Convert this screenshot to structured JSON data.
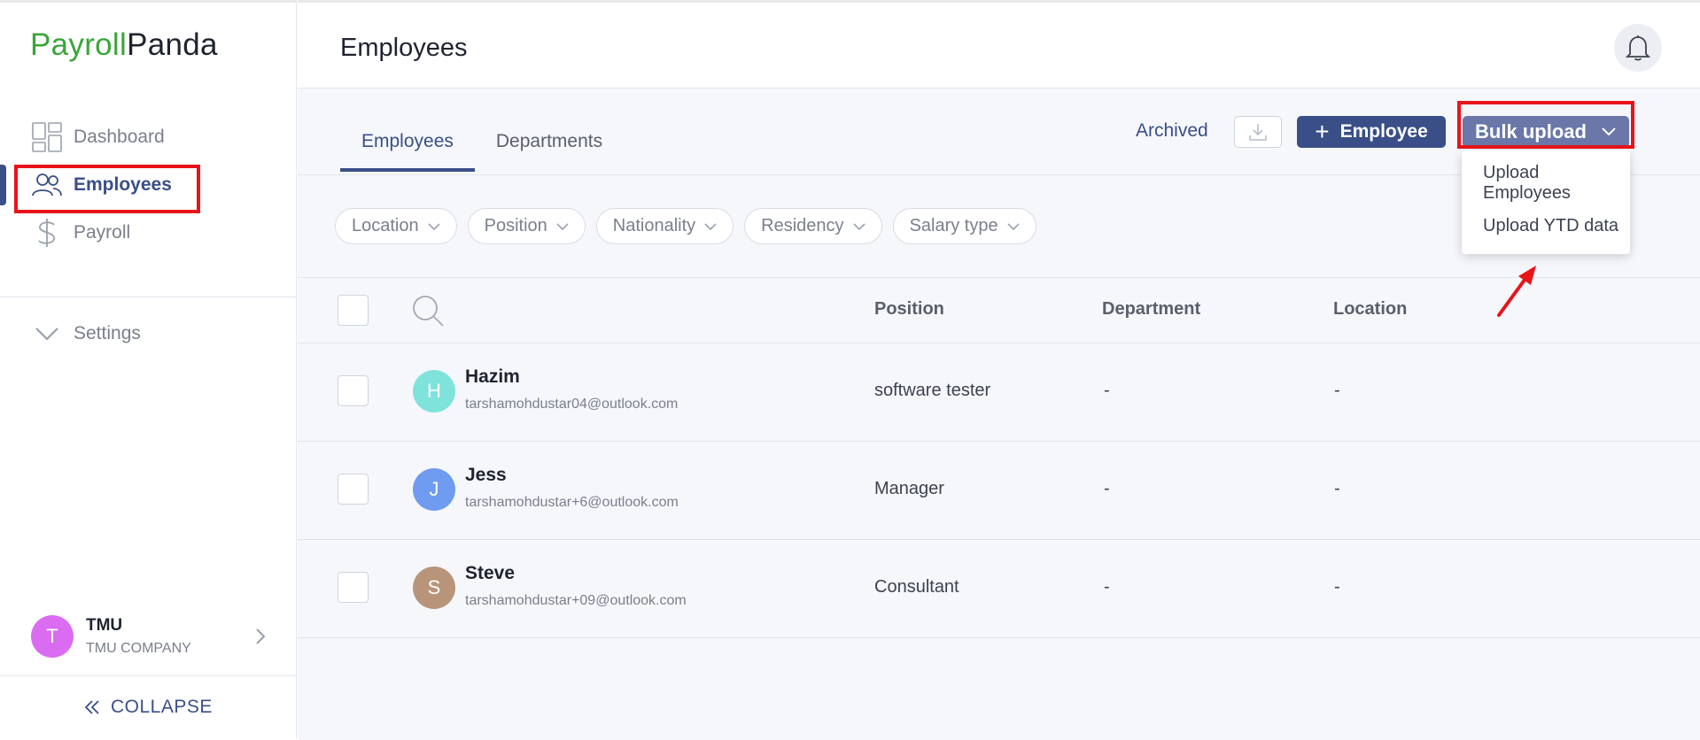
{
  "brand": {
    "part1": "Payroll",
    "part2": "Panda",
    "color_green": "#3aa639",
    "color_dark": "#1f2330"
  },
  "sidebar": {
    "items": [
      {
        "label": "Dashboard",
        "icon": "dashboard-icon"
      },
      {
        "label": "Employees",
        "icon": "users-icon",
        "active": true
      },
      {
        "label": "Payroll",
        "icon": "dollar-icon"
      }
    ],
    "settings": {
      "label": "Settings",
      "icon": "chevron-down-icon"
    },
    "user": {
      "initial": "T",
      "name": "TMU",
      "company": "TMU COMPANY"
    },
    "collapse": {
      "label": "COLLAPSE",
      "icon": "double-chevron-left-icon"
    }
  },
  "header": {
    "title": "Employees",
    "icon": "bell-icon"
  },
  "tabs": [
    {
      "label": "Employees",
      "active": true
    },
    {
      "label": "Departments",
      "active": false
    }
  ],
  "toolbar": {
    "archived_label": "Archived",
    "download_icon": "download-icon",
    "add_employee_label": "Employee",
    "bulk_upload_label": "Bulk upload",
    "bulk_menu": [
      "Upload Employees",
      "Upload YTD data"
    ]
  },
  "filters": [
    "Location",
    "Position",
    "Nationality",
    "Residency",
    "Salary type"
  ],
  "table": {
    "columns": [
      "Position",
      "Department",
      "Location"
    ],
    "rows": [
      {
        "initial": "H",
        "name": "Hazim",
        "email": "tarshamohdustar04@outlook.com",
        "position": "software tester",
        "department": "-",
        "location": "-",
        "avatar_color": "#7fe3dc"
      },
      {
        "initial": "J",
        "name": "Jess",
        "email": "tarshamohdustar+6@outlook.com",
        "position": "Manager",
        "department": "-",
        "location": "-",
        "avatar_color": "#6f9bf0"
      },
      {
        "initial": "S",
        "name": "Steve",
        "email": "tarshamohdustar+09@outlook.com",
        "position": "Consultant",
        "department": "-",
        "location": "-",
        "avatar_color": "#b8957a"
      }
    ]
  },
  "colors": {
    "accent": "#3a4f87",
    "bulk_button": "#6a77a8",
    "highlight_red": "#e8141a"
  }
}
